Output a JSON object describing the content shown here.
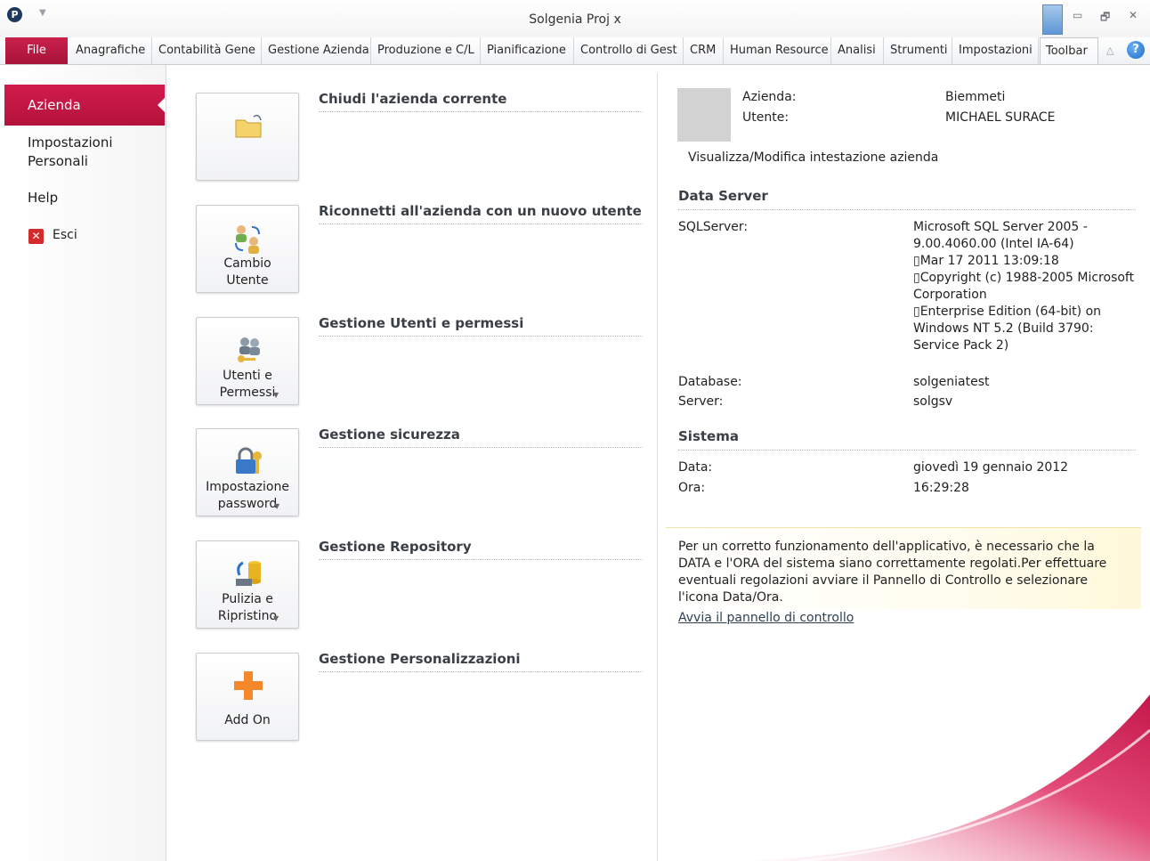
{
  "window": {
    "title": "Solgenia Proj x",
    "controls": [
      "▭",
      "🗗",
      "✕"
    ]
  },
  "ribbon": {
    "file_label": "File",
    "tabs": [
      {
        "label": "Anagrafiche"
      },
      {
        "label": "Contabilità Gene"
      },
      {
        "label": "Gestione Azienda"
      },
      {
        "label": "Produzione e C/L"
      },
      {
        "label": "Pianificazione"
      },
      {
        "label": "Controllo di Gest"
      },
      {
        "label": "CRM"
      },
      {
        "label": "Human Resource"
      },
      {
        "label": "Analisi"
      },
      {
        "label": "Strumenti"
      },
      {
        "label": "Impostazioni"
      },
      {
        "label": "Toolbar"
      }
    ],
    "help_symbol": "?"
  },
  "nav": {
    "items": [
      {
        "label": "Azienda"
      },
      {
        "label": "Impostazioni\nPersonali"
      },
      {
        "label": "Help"
      },
      {
        "label": "Esci"
      }
    ]
  },
  "commands": [
    {
      "heading": "Chiudi l'azienda corrente",
      "label": "",
      "has_dropdown": false
    },
    {
      "heading": "Riconnetti all'azienda con un nuovo utente",
      "label": "Cambio\nUtente",
      "has_dropdown": false
    },
    {
      "heading": "Gestione Utenti e permessi",
      "label": "Utenti e\nPermessi",
      "has_dropdown": true
    },
    {
      "heading": "Gestione sicurezza",
      "label": "Impostazione\npassword",
      "has_dropdown": true
    },
    {
      "heading": "Gestione Repository",
      "label": "Pulizia e\nRipristino",
      "has_dropdown": true
    },
    {
      "heading": "Gestione Personalizzazioni",
      "label": "Add On",
      "has_dropdown": false
    }
  ],
  "company": {
    "azienda_label": "Azienda:",
    "azienda_value": "Biemmeti",
    "utente_label": "Utente:",
    "utente_value": "MICHAEL SURACE",
    "edit_link": "Visualizza/Modifica intestazione azienda"
  },
  "server": {
    "heading": "Data Server",
    "sql_label": "SQLServer:",
    "sql_value": "Microsoft SQL Server 2005 - 9.00.4060.00 (Intel IA-64)\n▯Mar 17 2011 13:09:18\n▯Copyright (c) 1988-2005 Microsoft Corporation\n▯Enterprise Edition (64-bit) on Windows NT 5.2 (Build 3790: Service Pack 2)",
    "db_label": "Database:",
    "db_value": "solgeniatest",
    "server_label": "Server:",
    "server_value": "solgsv"
  },
  "system": {
    "heading": "Sistema",
    "date_label": "Data:",
    "date_value": "giovedì 19 gennaio 2012",
    "time_label": "Ora:",
    "time_value": "16:29:28"
  },
  "notice": {
    "text": "Per un corretto funzionamento dell'applicativo, è necessario che la DATA e l'ORA del sistema siano correttamente regolati.Per effettuare eventuali regolazioni avviare il Pannello di Controllo e selezionare l'icona Data/Ora.",
    "link": "Avvia il pannello di controllo"
  },
  "colors": {
    "accent": "#c4174a",
    "heading": "#3a3f45",
    "notice_bg": "#fff8d9"
  }
}
